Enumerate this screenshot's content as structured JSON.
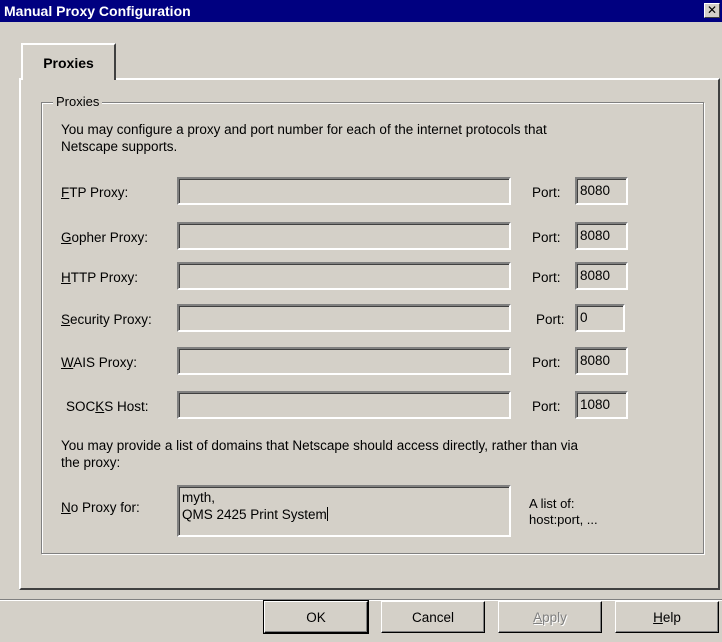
{
  "window": {
    "title": "Manual Proxy Configuration",
    "close_glyph": "✕"
  },
  "tabs": [
    {
      "label": "Proxies",
      "selected": true
    }
  ],
  "group": {
    "label": "Proxies",
    "intro_line1": "You may configure a proxy and port number for each of the internet protocols that",
    "intro_line2": "Netscape supports."
  },
  "proxies": [
    {
      "label": "FTP Proxy:",
      "mnemonic": "F",
      "value": "",
      "port_label": "Port:",
      "port": "8080"
    },
    {
      "label": "Gopher Proxy:",
      "mnemonic": "G",
      "value": "",
      "port_label": "Port:",
      "port": "8080"
    },
    {
      "label": "HTTP Proxy:",
      "mnemonic": "H",
      "value": "",
      "port_label": "Port:",
      "port": "8080"
    },
    {
      "label": "Security Proxy:",
      "mnemonic": "S",
      "value": "",
      "port_label": "Port:",
      "port": "0"
    },
    {
      "label": "WAIS Proxy:",
      "mnemonic": "W",
      "value": "",
      "port_label": "Port:",
      "port": "8080"
    },
    {
      "label": "SOCKS Host:",
      "mnemonic": "K",
      "value": "",
      "port_label": "Port:",
      "port": "1080"
    }
  ],
  "no_proxy": {
    "intro_line1": "You may provide a list of domains that Netscape should access directly, rather than via",
    "intro_line2": "the proxy:",
    "label": "No Proxy for:",
    "lines": [
      "myth,",
      "QMS 2425 Print System"
    ],
    "hint_line1": "A list of:",
    "hint_line2": "host:port, ..."
  },
  "buttons": {
    "ok": "OK",
    "cancel": "Cancel",
    "apply": "Apply",
    "help": "Help"
  }
}
